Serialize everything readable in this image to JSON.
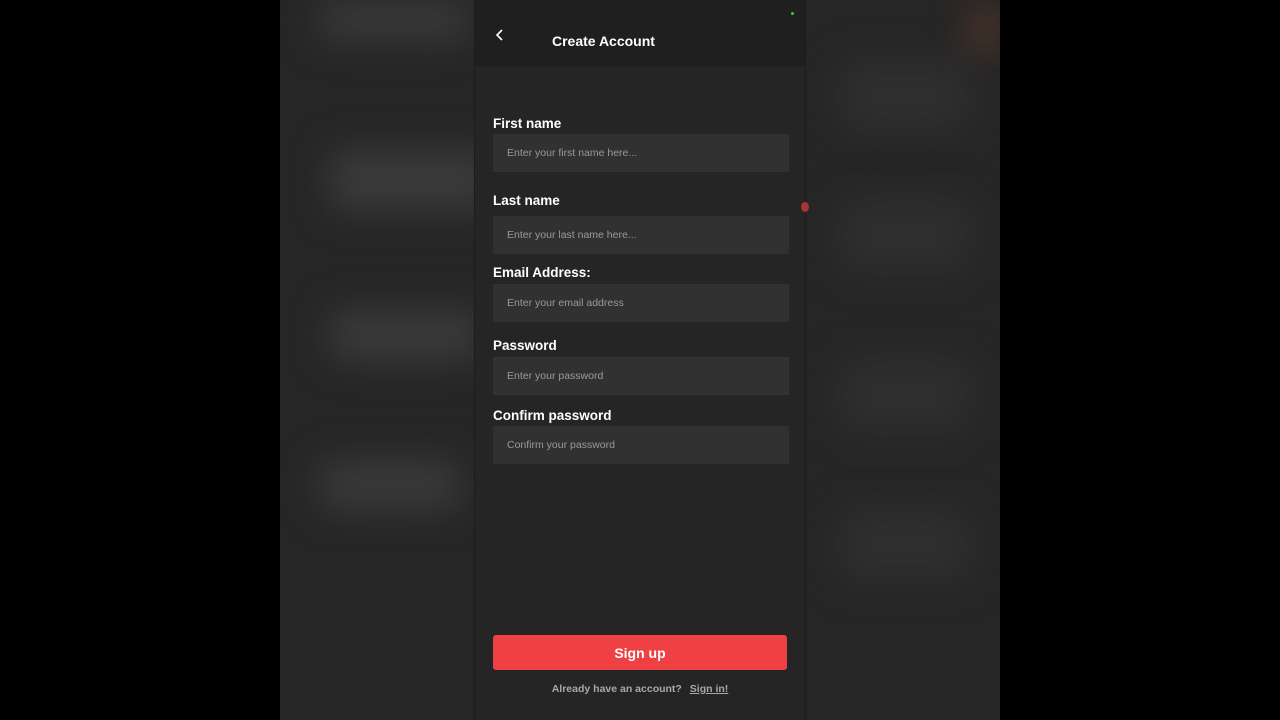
{
  "header": {
    "title": "Create Account",
    "back_icon": "chevron-left-icon"
  },
  "form": {
    "fields": [
      {
        "label": "First name",
        "placeholder": "Enter your first name here...",
        "value": ""
      },
      {
        "label": "Last name",
        "placeholder": "Enter your last name here...",
        "value": ""
      },
      {
        "label": "Email Address:",
        "placeholder": "Enter your email address",
        "value": ""
      },
      {
        "label": "Password",
        "placeholder": "Enter your password",
        "value": ""
      },
      {
        "label": "Confirm password",
        "placeholder": "Confirm your password",
        "value": ""
      }
    ],
    "submit_label": "Sign up"
  },
  "footer": {
    "question": "Already have an account?",
    "signin_label": "Sign in!"
  },
  "colors": {
    "accent": "#ef4043",
    "background": "#252525",
    "header": "#1f1f1f",
    "input": "#313131"
  }
}
